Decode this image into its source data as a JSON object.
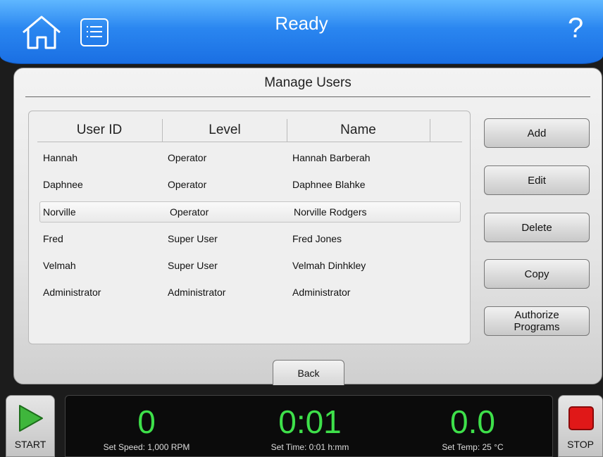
{
  "header": {
    "title": "Ready",
    "help_label": "?"
  },
  "panel": {
    "title": "Manage Users"
  },
  "table": {
    "columns": [
      "User ID",
      "Level",
      "Name"
    ],
    "rows": [
      {
        "user_id": "Hannah",
        "level": "Operator",
        "name": "Hannah Barberah",
        "selected": false
      },
      {
        "user_id": "Daphnee",
        "level": "Operator",
        "name": "Daphnee Blahke",
        "selected": false
      },
      {
        "user_id": "Norville",
        "level": "Operator",
        "name": "Norville Rodgers",
        "selected": true
      },
      {
        "user_id": "Fred",
        "level": "Super User",
        "name": "Fred Jones",
        "selected": false
      },
      {
        "user_id": "Velmah",
        "level": "Super User",
        "name": "Velmah Dinhkley",
        "selected": false
      },
      {
        "user_id": "Administrator",
        "level": "Administrator",
        "name": "Administrator",
        "selected": false
      }
    ]
  },
  "actions": {
    "add": "Add",
    "edit": "Edit",
    "delete": "Delete",
    "copy": "Copy",
    "authorize_line1": "Authorize",
    "authorize_line2": "Programs",
    "back": "Back"
  },
  "footer": {
    "start_label": "START",
    "stop_label": "STOP",
    "speed_value": "0",
    "speed_label": "Set Speed: 1,000 RPM",
    "time_value": "0:01",
    "time_label": "Set Time: 0:01 h:mm",
    "temp_value": "0.0",
    "temp_label": "Set Temp: 25 °C"
  },
  "colors": {
    "header_blue": "#2a86f0",
    "readout_green": "#3ee04a",
    "stop_red": "#e01818",
    "start_green": "#3fb63c"
  },
  "icons": {
    "home": "home-icon",
    "menu": "list-menu-icon",
    "help": "help-icon",
    "start": "play-icon",
    "stop": "stop-icon"
  }
}
